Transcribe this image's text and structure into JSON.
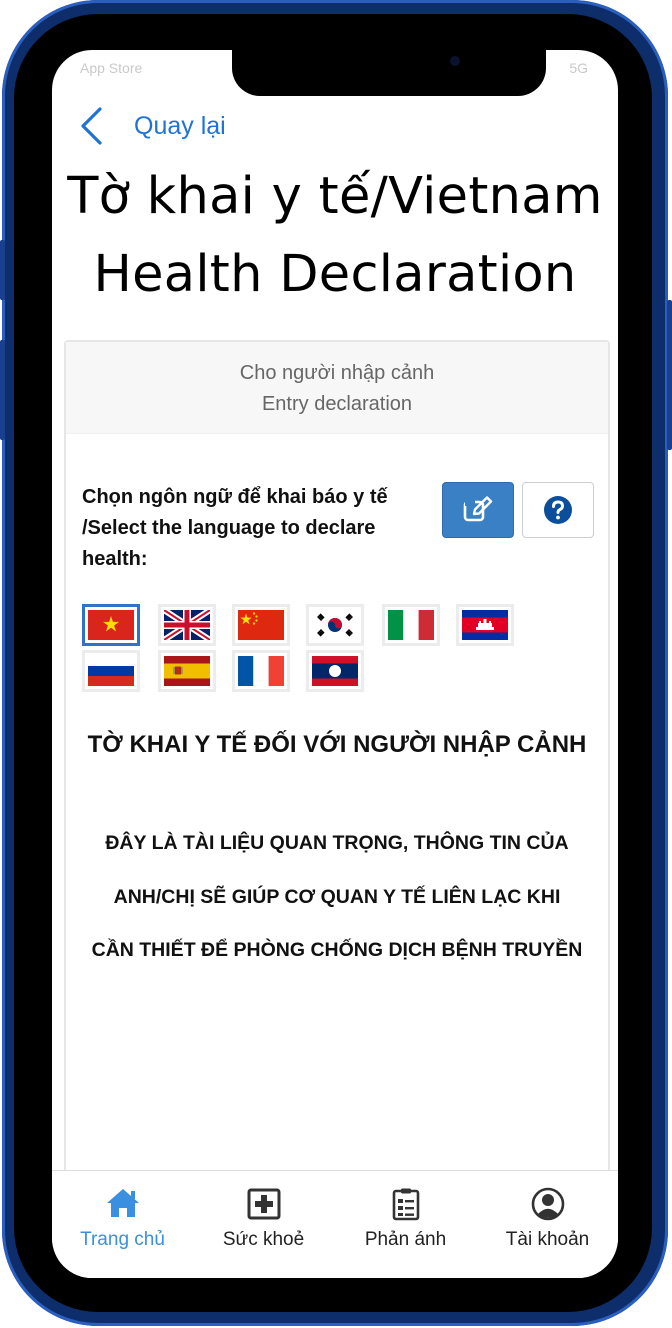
{
  "status_bar": {
    "left": "App Store",
    "right": "5G"
  },
  "header": {
    "back_label": "Quay lại",
    "title_line1": "Tờ khai y tế/Vietnam",
    "title_line2": "Health Declaration"
  },
  "card": {
    "header_line1": "Cho người nhập cảnh",
    "header_line2": "Entry declaration",
    "language_prompt": "Chọn ngôn ngữ để khai báo y tế /Select the language to declare health:",
    "edit_icon": "edit-icon",
    "help_icon": "question-circle-icon",
    "flags": [
      "vietnam",
      "united-kingdom",
      "china",
      "south-korea",
      "italy",
      "cambodia",
      "russia",
      "spain",
      "france",
      "laos"
    ],
    "selected_flag": "vietnam",
    "declaration_title": "TỜ KHAI Y TẾ ĐỐI VỚI NGƯỜI NHẬP CẢNH",
    "declaration_lines": [
      "ĐÂY LÀ TÀI LIỆU QUAN TRỌNG, THÔNG TIN CỦA",
      "ANH/CHỊ SẼ GIÚP CƠ QUAN Y TẾ LIÊN LẠC KHI",
      "CẦN THIẾT ĐỂ PHÒNG CHỐNG DỊCH BỆNH TRUYỀN"
    ]
  },
  "tabbar": {
    "tabs": [
      {
        "label": "Trang chủ",
        "icon": "home-icon",
        "active": true
      },
      {
        "label": "Sức khoẻ",
        "icon": "medical-cross-icon",
        "active": false
      },
      {
        "label": "Phản ánh",
        "icon": "clipboard-icon",
        "active": false
      },
      {
        "label": "Tài khoản",
        "icon": "account-icon",
        "active": false
      }
    ]
  },
  "colors": {
    "accent": "#1f73d6",
    "active_tab": "#3a8fe0",
    "primary_button": "#3a80c4",
    "frame": "#0d2d6b"
  }
}
